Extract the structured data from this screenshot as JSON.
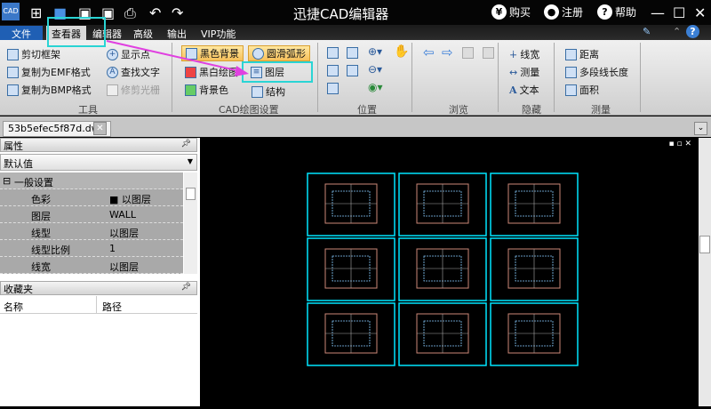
{
  "app": {
    "title": "迅捷CAD编辑器",
    "logo": "CAD",
    "buy": "购买",
    "register": "注册",
    "help": "帮助"
  },
  "menu": [
    "文件",
    "查看器",
    "编辑器",
    "高级",
    "输出",
    "VIP功能"
  ],
  "ribbon": {
    "tools": {
      "items": [
        "剪切框架",
        "复制为EMF格式",
        "复制为BMP格式",
        "显示点",
        "查找文字",
        "修剪光栅"
      ],
      "label": "工具"
    },
    "cad": {
      "items": [
        "黑色背景",
        "黑白绘图",
        "背景色",
        "圆滑弧形",
        "图层",
        "结构"
      ],
      "label": "CAD绘图设置"
    },
    "position": {
      "label": "位置"
    },
    "browse": {
      "label": "浏览"
    },
    "hide": {
      "items": [
        "线宽",
        "测量",
        "文本"
      ],
      "label": "隐藏"
    },
    "measure": {
      "items": [
        "距离",
        "多段线长度",
        "面积"
      ],
      "label": "测量"
    }
  },
  "document": {
    "tab": "53b5efec5f87d.dwg"
  },
  "properties": {
    "title": "属性",
    "dropdown": "默认值",
    "section": "一般设置",
    "rows": [
      {
        "k": "色彩",
        "v": "以图层"
      },
      {
        "k": "图层",
        "v": "WALL"
      },
      {
        "k": "线型",
        "v": "以图层"
      },
      {
        "k": "线型比例",
        "v": "1"
      },
      {
        "k": "线宽",
        "v": "以图层"
      }
    ]
  },
  "favorites": {
    "title": "收藏夹",
    "columns": [
      "名称",
      "路径"
    ]
  },
  "colors": {
    "highlight": "#2ad4d4",
    "arrow": "#e040e0",
    "sheet_border": "#00e5ff",
    "file_tab": "#1f5fb4"
  }
}
